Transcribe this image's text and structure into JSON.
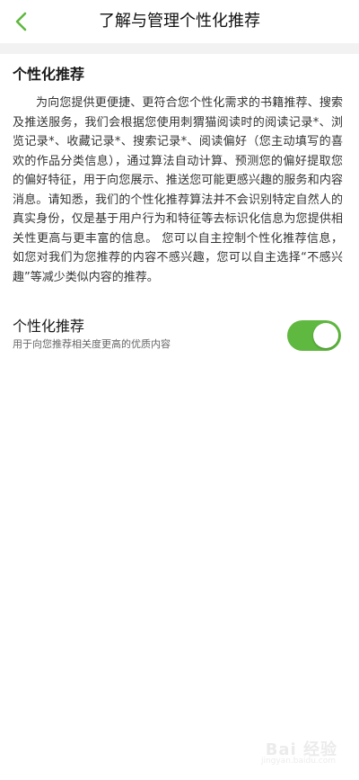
{
  "header": {
    "title": "了解与管理个性化推荐",
    "back_icon": "chevron-left-icon",
    "accent_color": "#5fb83f"
  },
  "section": {
    "title": "个性化推荐",
    "body": "为向您提供更便捷、更符合您个性化需求的书籍推荐、搜索及推送服务，我们会根据您使用刺猬猫阅读时的阅读记录*、浏览记录*、收藏记录*、搜索记录*、阅读偏好（您主动填写的喜欢的作品分类信息），通过算法自动计算、预测您的偏好提取您的偏好特征，用于向您展示、推送您可能更感兴趣的服务和内容消息。请知悉，我们的个性化推荐算法并不会识别特定自然人的真实身份，仅是基于用户行为和特征等去标识化信息为您提供相关性更高与更丰富的信息。 您可以自主控制个性化推荐信息，如您对我们为您推荐的内容不感兴趣，您可以自主选择“不感兴趣”等减少类似内容的推荐。"
  },
  "setting": {
    "title": "个性化推荐",
    "description": "用于向您推荐相关度更高的优质内容",
    "enabled": true,
    "toggle_color": "#5fb83f"
  },
  "watermark": {
    "text": "Bai 经验",
    "sub": "jingyan.baidu.com"
  }
}
